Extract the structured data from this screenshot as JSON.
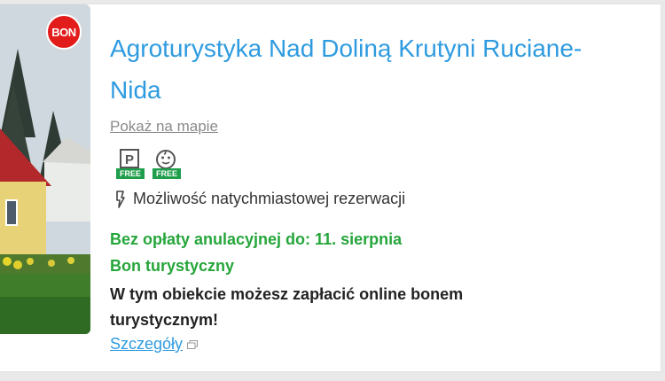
{
  "listing": {
    "badge": "BON",
    "title": "Agroturystyka Nad Doliną Krutyni Ruciane-Nida",
    "map_link": "Pokaż na mapie",
    "amenities": [
      {
        "icon": "parking-icon",
        "label": "P",
        "tag": "FREE"
      },
      {
        "icon": "child-face-icon",
        "tag": "FREE"
      }
    ],
    "instant_booking": "Możliwość natychmiastowej rezerwacji",
    "free_cancellation": "Bez opłaty anulacyjnej do: 11. sierpnia",
    "bon_heading": "Bon turystyczny",
    "bon_description": "W tym obiekcie możesz zapłacić online bonem turystycznym!",
    "details_link": "Szczegóły"
  },
  "colors": {
    "title_blue": "#2e9be0",
    "green": "#25a63a",
    "badge_red": "#e21b1b",
    "free_green": "#1e9e4a"
  }
}
